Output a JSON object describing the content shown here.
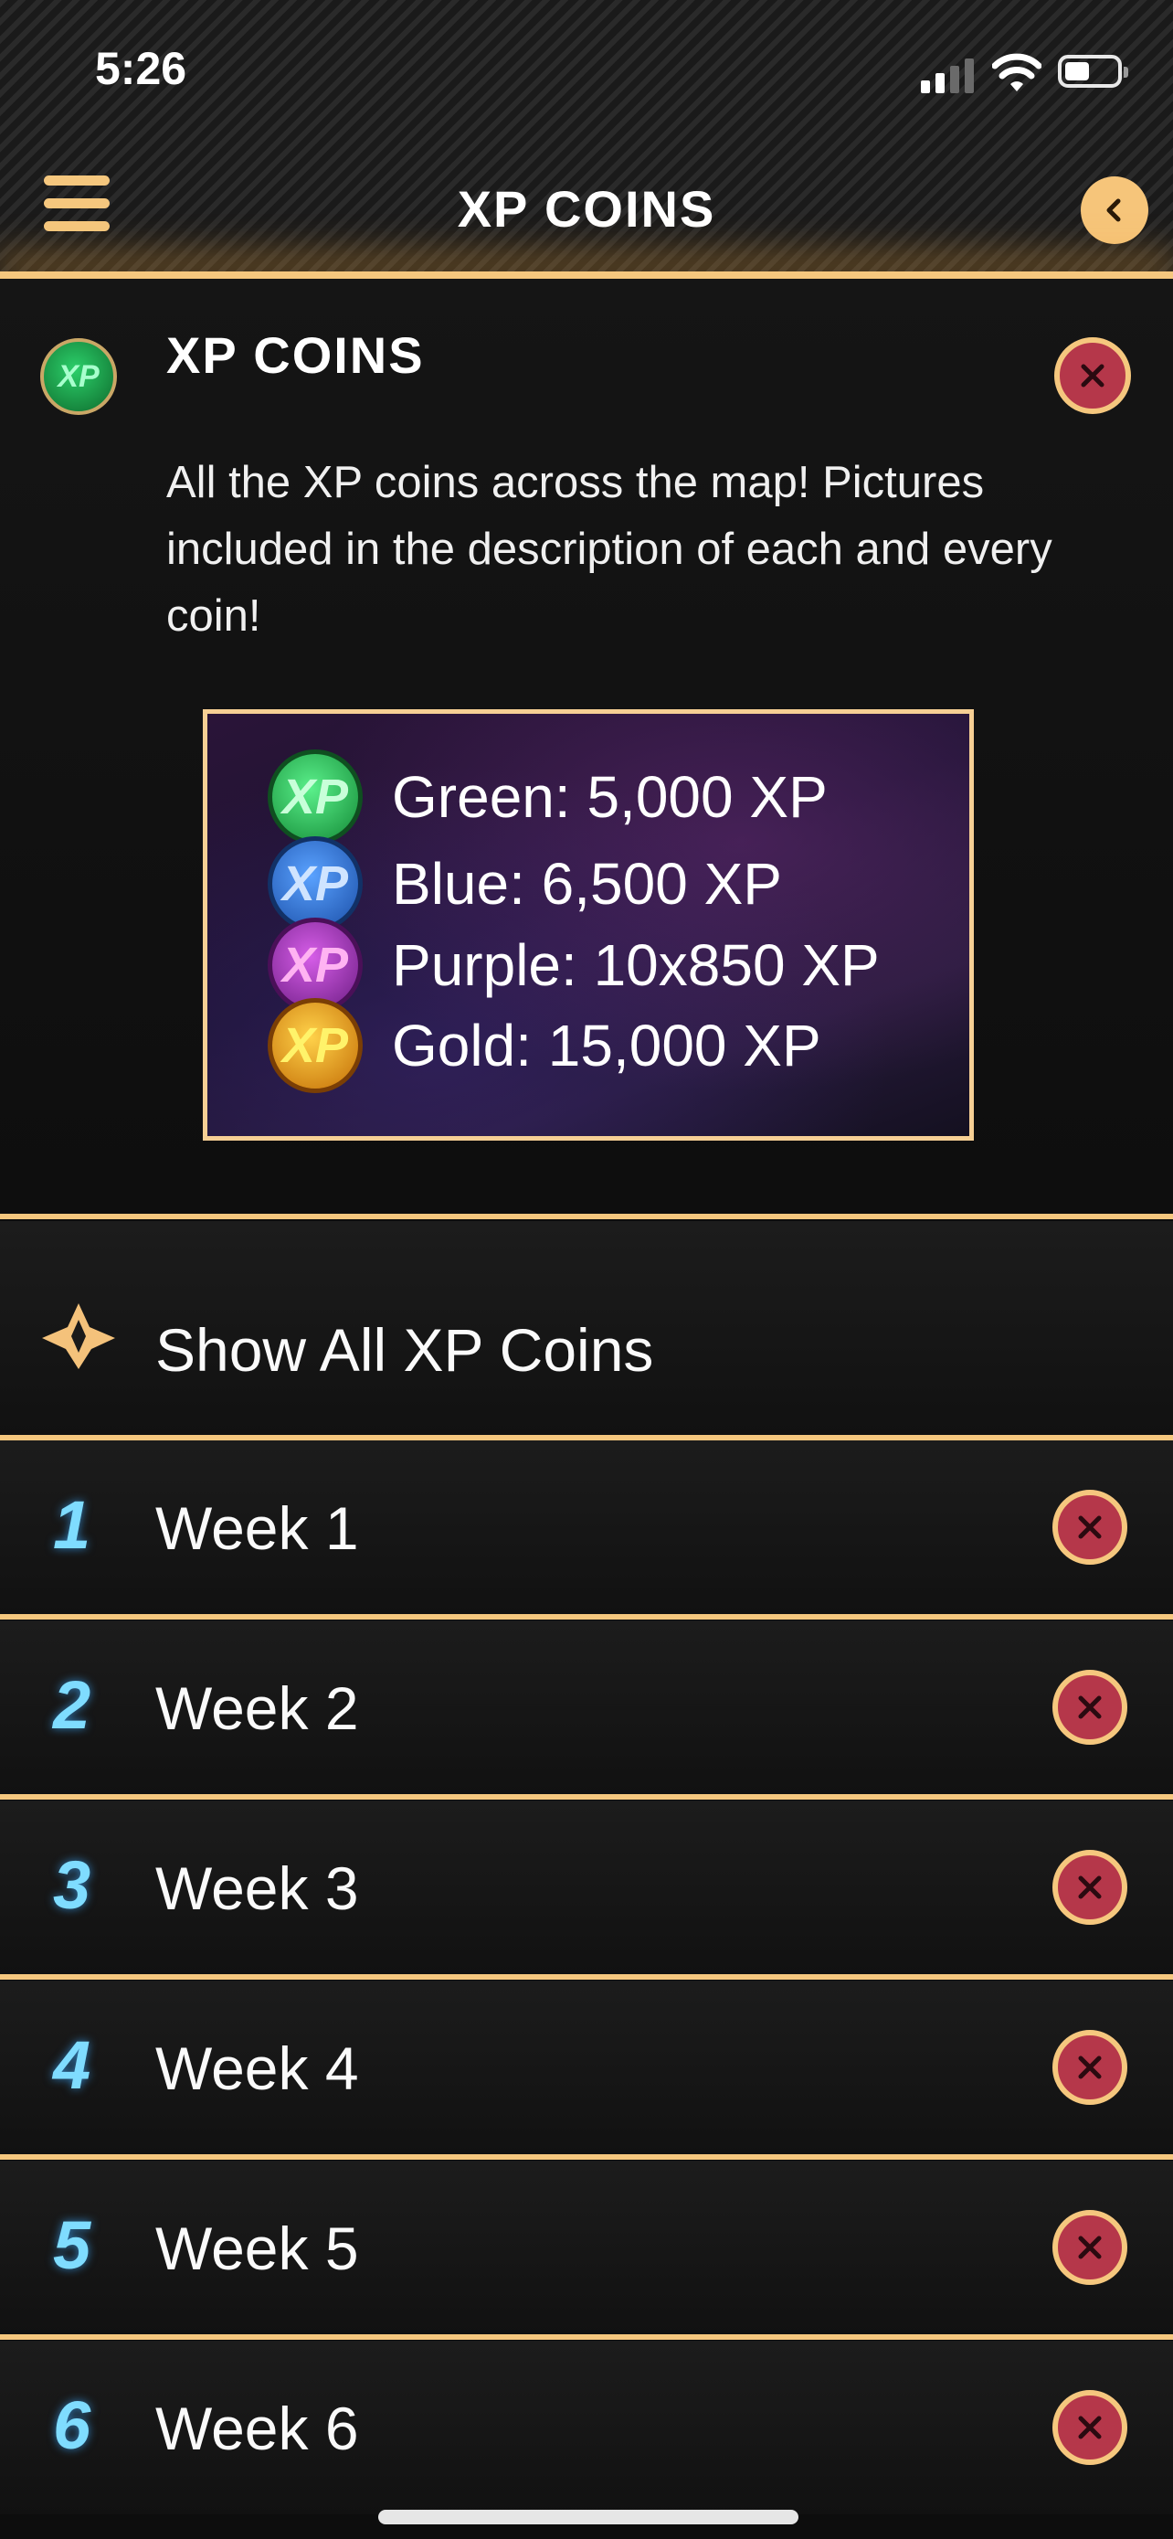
{
  "status_bar": {
    "time": "5:26"
  },
  "header": {
    "title": "XP COINS"
  },
  "info": {
    "title": "XP COINS",
    "badge_text": "XP",
    "description": "All the XP coins across the map! Pictures included in the description of each and every coin!"
  },
  "coins": [
    {
      "label": "Green: 5,000 XP",
      "coin_text": "XP",
      "color": "#27c35c"
    },
    {
      "label": "Blue: 6,500 XP",
      "coin_text": "XP",
      "color": "#2d73d6"
    },
    {
      "label": "Purple: 10x850 XP",
      "coin_text": "XP",
      "color": "#a336b8"
    },
    {
      "label": "Gold: 15,000 XP",
      "coin_text": "XP",
      "color": "#e9a21a"
    }
  ],
  "show_all": {
    "label": "Show All XP Coins"
  },
  "weeks": [
    {
      "number": "1",
      "label": "Week 1"
    },
    {
      "number": "2",
      "label": "Week 2"
    },
    {
      "number": "3",
      "label": "Week 3"
    },
    {
      "number": "4",
      "label": "Week 4"
    },
    {
      "number": "5",
      "label": "Week 5"
    },
    {
      "number": "6",
      "label": "Week 6"
    }
  ],
  "colors": {
    "accent": "#f5c77e",
    "close_fill": "#b5374a",
    "week_number": "#7fdcff"
  }
}
